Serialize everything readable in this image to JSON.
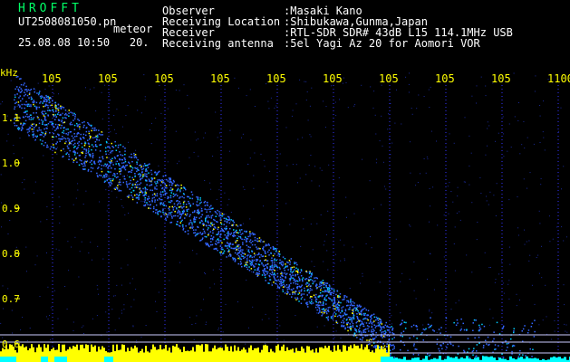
{
  "app_title": "HROFFT",
  "filename": "UT2508081050.pn",
  "filename_suffix": "meteor",
  "timestamp": "25.08.08 10:50",
  "scan_seconds": "20.",
  "info": [
    {
      "label": "Observer",
      "value": ":Masaki Kano"
    },
    {
      "label": "Receiving Location",
      "value": ":Shibukawa,Gunma,Japan"
    },
    {
      "label": "Receiver",
      "value": ":RTL-SDR SDR# 43dB L15 114.1MHz USB"
    },
    {
      "label": "Receiving antenna",
      "value": ":5el Yagi Az 20 for Aomori VOR"
    }
  ],
  "colors": {
    "title": "#00ff66",
    "labels": "#ffffff",
    "axis": "#ffff00",
    "grid": "#3333ff",
    "echo": "#3366ff",
    "signal": "#ffff00",
    "floor": "#00ffff"
  },
  "axis": {
    "unit": "kHz",
    "y_ticks": [
      "1.1",
      "1.0",
      "0.9",
      "0.8",
      "0.7",
      "0.6"
    ],
    "x_ticks": [
      "105",
      "105",
      "105",
      "105",
      "105",
      "105",
      "105",
      "105",
      "105",
      "1100"
    ]
  },
  "chart_data": {
    "type": "heatmap",
    "ylabel": "kHz",
    "y_tick_values": [
      1.1,
      1.0,
      0.9,
      0.8,
      0.7,
      0.6
    ],
    "x_tick_labels": [
      "105",
      "105",
      "105",
      "105",
      "105",
      "105",
      "105",
      "105",
      "105",
      "1100"
    ]
  }
}
